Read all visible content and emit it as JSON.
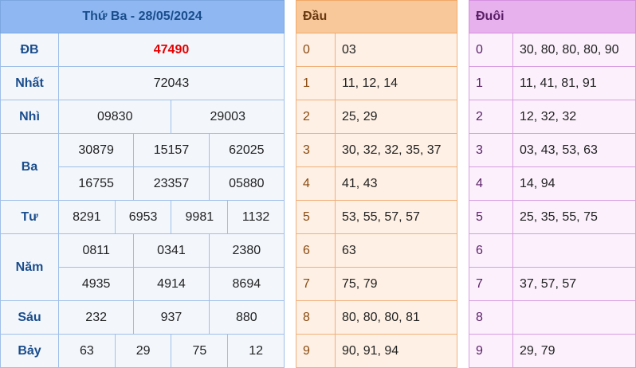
{
  "results": {
    "date_title": "Thứ Ba - 28/05/2024",
    "prizes": {
      "db": {
        "label": "ĐB",
        "values": [
          "47490"
        ]
      },
      "nhat": {
        "label": "Nhất",
        "values": [
          "72043"
        ]
      },
      "nhi": {
        "label": "Nhì",
        "values": [
          "09830",
          "29003"
        ]
      },
      "ba": {
        "label": "Ba",
        "values": [
          "30879",
          "15157",
          "62025",
          "16755",
          "23357",
          "05880"
        ]
      },
      "tu": {
        "label": "Tư",
        "values": [
          "8291",
          "6953",
          "9981",
          "1132"
        ]
      },
      "nam": {
        "label": "Năm",
        "values": [
          "0811",
          "0341",
          "2380",
          "4935",
          "4914",
          "8694"
        ]
      },
      "sau": {
        "label": "Sáu",
        "values": [
          "232",
          "937",
          "880"
        ]
      },
      "bay": {
        "label": "Bảy",
        "values": [
          "63",
          "29",
          "75",
          "12"
        ]
      }
    }
  },
  "dau": {
    "header": "Đầu",
    "rows": [
      {
        "digit": "0",
        "values": "03"
      },
      {
        "digit": "1",
        "values": "11, 12, 14"
      },
      {
        "digit": "2",
        "values": "25, 29"
      },
      {
        "digit": "3",
        "values": "30, 32, 32, 35, 37"
      },
      {
        "digit": "4",
        "values": "41, 43"
      },
      {
        "digit": "5",
        "values": "53, 55, 57, 57"
      },
      {
        "digit": "6",
        "values": "63"
      },
      {
        "digit": "7",
        "values": "75, 79"
      },
      {
        "digit": "8",
        "values": "80, 80, 80, 81"
      },
      {
        "digit": "9",
        "values": "90, 91, 94"
      }
    ]
  },
  "duoi": {
    "header": "Đuôi",
    "rows": [
      {
        "digit": "0",
        "values": "30, 80, 80, 80, 90"
      },
      {
        "digit": "1",
        "values": "11, 41, 81, 91"
      },
      {
        "digit": "2",
        "values": "12, 32, 32"
      },
      {
        "digit": "3",
        "values": "03, 43, 53, 63"
      },
      {
        "digit": "4",
        "values": "14, 94"
      },
      {
        "digit": "5",
        "values": "25, 35, 55, 75"
      },
      {
        "digit": "6",
        "values": ""
      },
      {
        "digit": "7",
        "values": "37, 57, 57"
      },
      {
        "digit": "8",
        "values": ""
      },
      {
        "digit": "9",
        "values": "29, 79"
      }
    ]
  }
}
